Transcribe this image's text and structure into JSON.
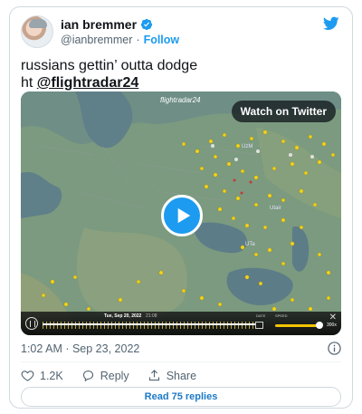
{
  "author": {
    "name": "ian bremmer",
    "handle": "@ianbremmer",
    "separator": "·",
    "follow_label": "Follow"
  },
  "tweet": {
    "line1": "russians gettin’ outta dodge",
    "line2_prefix": "ht ",
    "mention": "@flightradar24"
  },
  "media": {
    "watermark": "flightradar24",
    "watch_label": "Watch on Twitter",
    "map_labels": {
      "uzbek_lbl": "UzM",
      "uair_lbl": "Utair",
      "uta_lbl": "UTa"
    },
    "player": {
      "date": "Tue, Sep 20, 2022",
      "time": "21:08",
      "date_label": "DATE",
      "speed_label": "SPEED",
      "speed_value": "300x"
    }
  },
  "meta": {
    "timestamp": "1:02 AM · Sep 23, 2022"
  },
  "actions": {
    "likes": "1.2K",
    "reply_label": "Reply",
    "share_label": "Share"
  },
  "read_replies_label": "Read 75 replies",
  "colors": {
    "twitter_blue": "#1d9bf0",
    "plane_yellow": "#f2d21b"
  }
}
